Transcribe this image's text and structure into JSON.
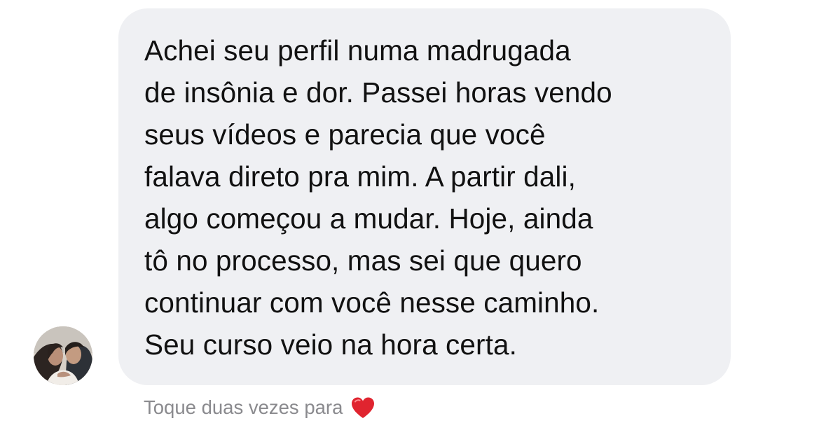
{
  "conversation": {
    "message": {
      "text": "Achei seu perfil numa madrugada\nde insônia e dor. Passei horas vendo\nseus vídeos e parecia que você\nfalava direto pra mim. A partir dali,\nalgo começou a mudar. Hoje, ainda\ntô no processo, mas sei que quero\ncontinuar com você nesse caminho.\nSeu curso veio na hora certa.",
      "bubble_color": "#eff0f3",
      "text_color": "#111111"
    },
    "sender_avatar": {
      "icon": "profile-photo"
    },
    "reaction_hint": {
      "label": "Toque duas vezes para",
      "icon": "heart-icon",
      "heart_color": "#e0242f"
    }
  }
}
